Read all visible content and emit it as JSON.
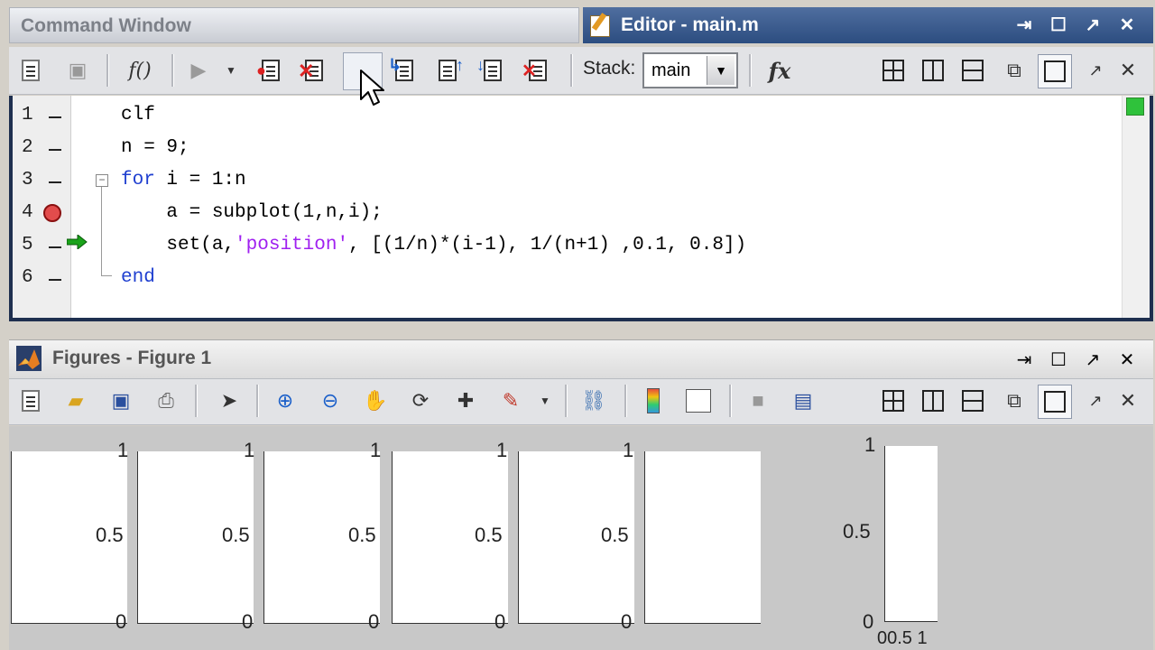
{
  "command_window": {
    "title": "Command Window"
  },
  "editor": {
    "title": "Editor - main.m",
    "toolbar": {
      "stack_label": "Stack:",
      "stack_value": "main",
      "fx_label": "fx",
      "function_label": "f()"
    },
    "lines": [
      {
        "num": "1",
        "code": "clf"
      },
      {
        "num": "2",
        "code": "n = 9;"
      },
      {
        "num": "3",
        "code_kw": "for",
        "code_rest": " i = 1:n"
      },
      {
        "num": "4",
        "code": "    a = subplot(1,n,i);"
      },
      {
        "num": "5",
        "code_a": "    set(a,",
        "code_str": "'position'",
        "code_b": ", [(1/n)*(i-1), 1/(n+1) ,0.1, 0.8])"
      },
      {
        "num": "6",
        "code_kw": "end"
      }
    ]
  },
  "figures": {
    "title": "Figures - Figure 1"
  },
  "plot": {
    "tick_top": "1",
    "tick_mid": "0.5",
    "tick_zero": "0",
    "tick_last_bottom": "00.5 1"
  },
  "colors": {
    "editor_title_bg": "#2c4d80",
    "keyword": "#1f3fd0",
    "string": "#a020f0",
    "breakpoint": "#e24c4c",
    "exec_arrow": "#1aa31a"
  }
}
